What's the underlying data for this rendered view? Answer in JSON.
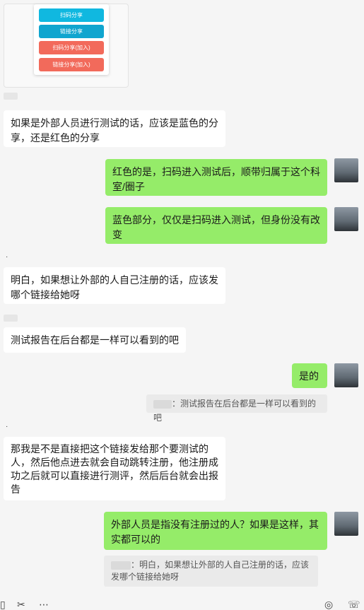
{
  "share_card": {
    "buttons": [
      {
        "label": "扫码分享",
        "color": "#10b8e0"
      },
      {
        "label": "链接分享",
        "color": "#10a5cf"
      },
      {
        "label": "扫码分享(加入)",
        "color": "#f26a5b"
      },
      {
        "label": "链接分享(加入)",
        "color": "#f26a5b"
      }
    ]
  },
  "messages": [
    {
      "side": "left",
      "text": "如果是外部人员进行测试的话，应该是蓝色的分享，还是红色的分享"
    },
    {
      "side": "right",
      "text": "红色的是，扫码进入测试后，顺带归属于这个科室/圈子"
    },
    {
      "side": "right",
      "text": "蓝色部分，仅仅是扫码进入测试，但身份没有改变"
    },
    {
      "side": "left",
      "text": "明白，如果想让外部的人自己注册的话，应该发哪个链接给她呀"
    },
    {
      "side": "left",
      "text": "测试报告在后台都是一样可以看到的吧"
    },
    {
      "side": "right",
      "text": "是的"
    },
    {
      "side": "left",
      "text": "那我是不是直接把这个链接发给那个要测试的人，然后他点进去就会自动跳转注册，他注册成功之后就可以直接进行测评，然后后台就会出报告"
    },
    {
      "side": "right",
      "text": "外部人员是指没有注册过的人？如果是这样，其实都可以的"
    }
  ],
  "quotes": [
    {
      "text": "：测试报告在后台都是一样可以看到的吧"
    },
    {
      "text": "：明白，如果想让外部的人自己注册的话，应该发哪个链接给她呀"
    }
  ],
  "sender_marks": [
    "·",
    "·"
  ],
  "toolbar": {
    "icons": [
      "folder-icon",
      "scissors-icon",
      "chat-history-icon",
      "voice-call-icon",
      "video-call-icon"
    ]
  },
  "colors": {
    "bubble_right": "#95ec69",
    "bubble_left": "#ffffff",
    "background": "#f5f5f5"
  }
}
